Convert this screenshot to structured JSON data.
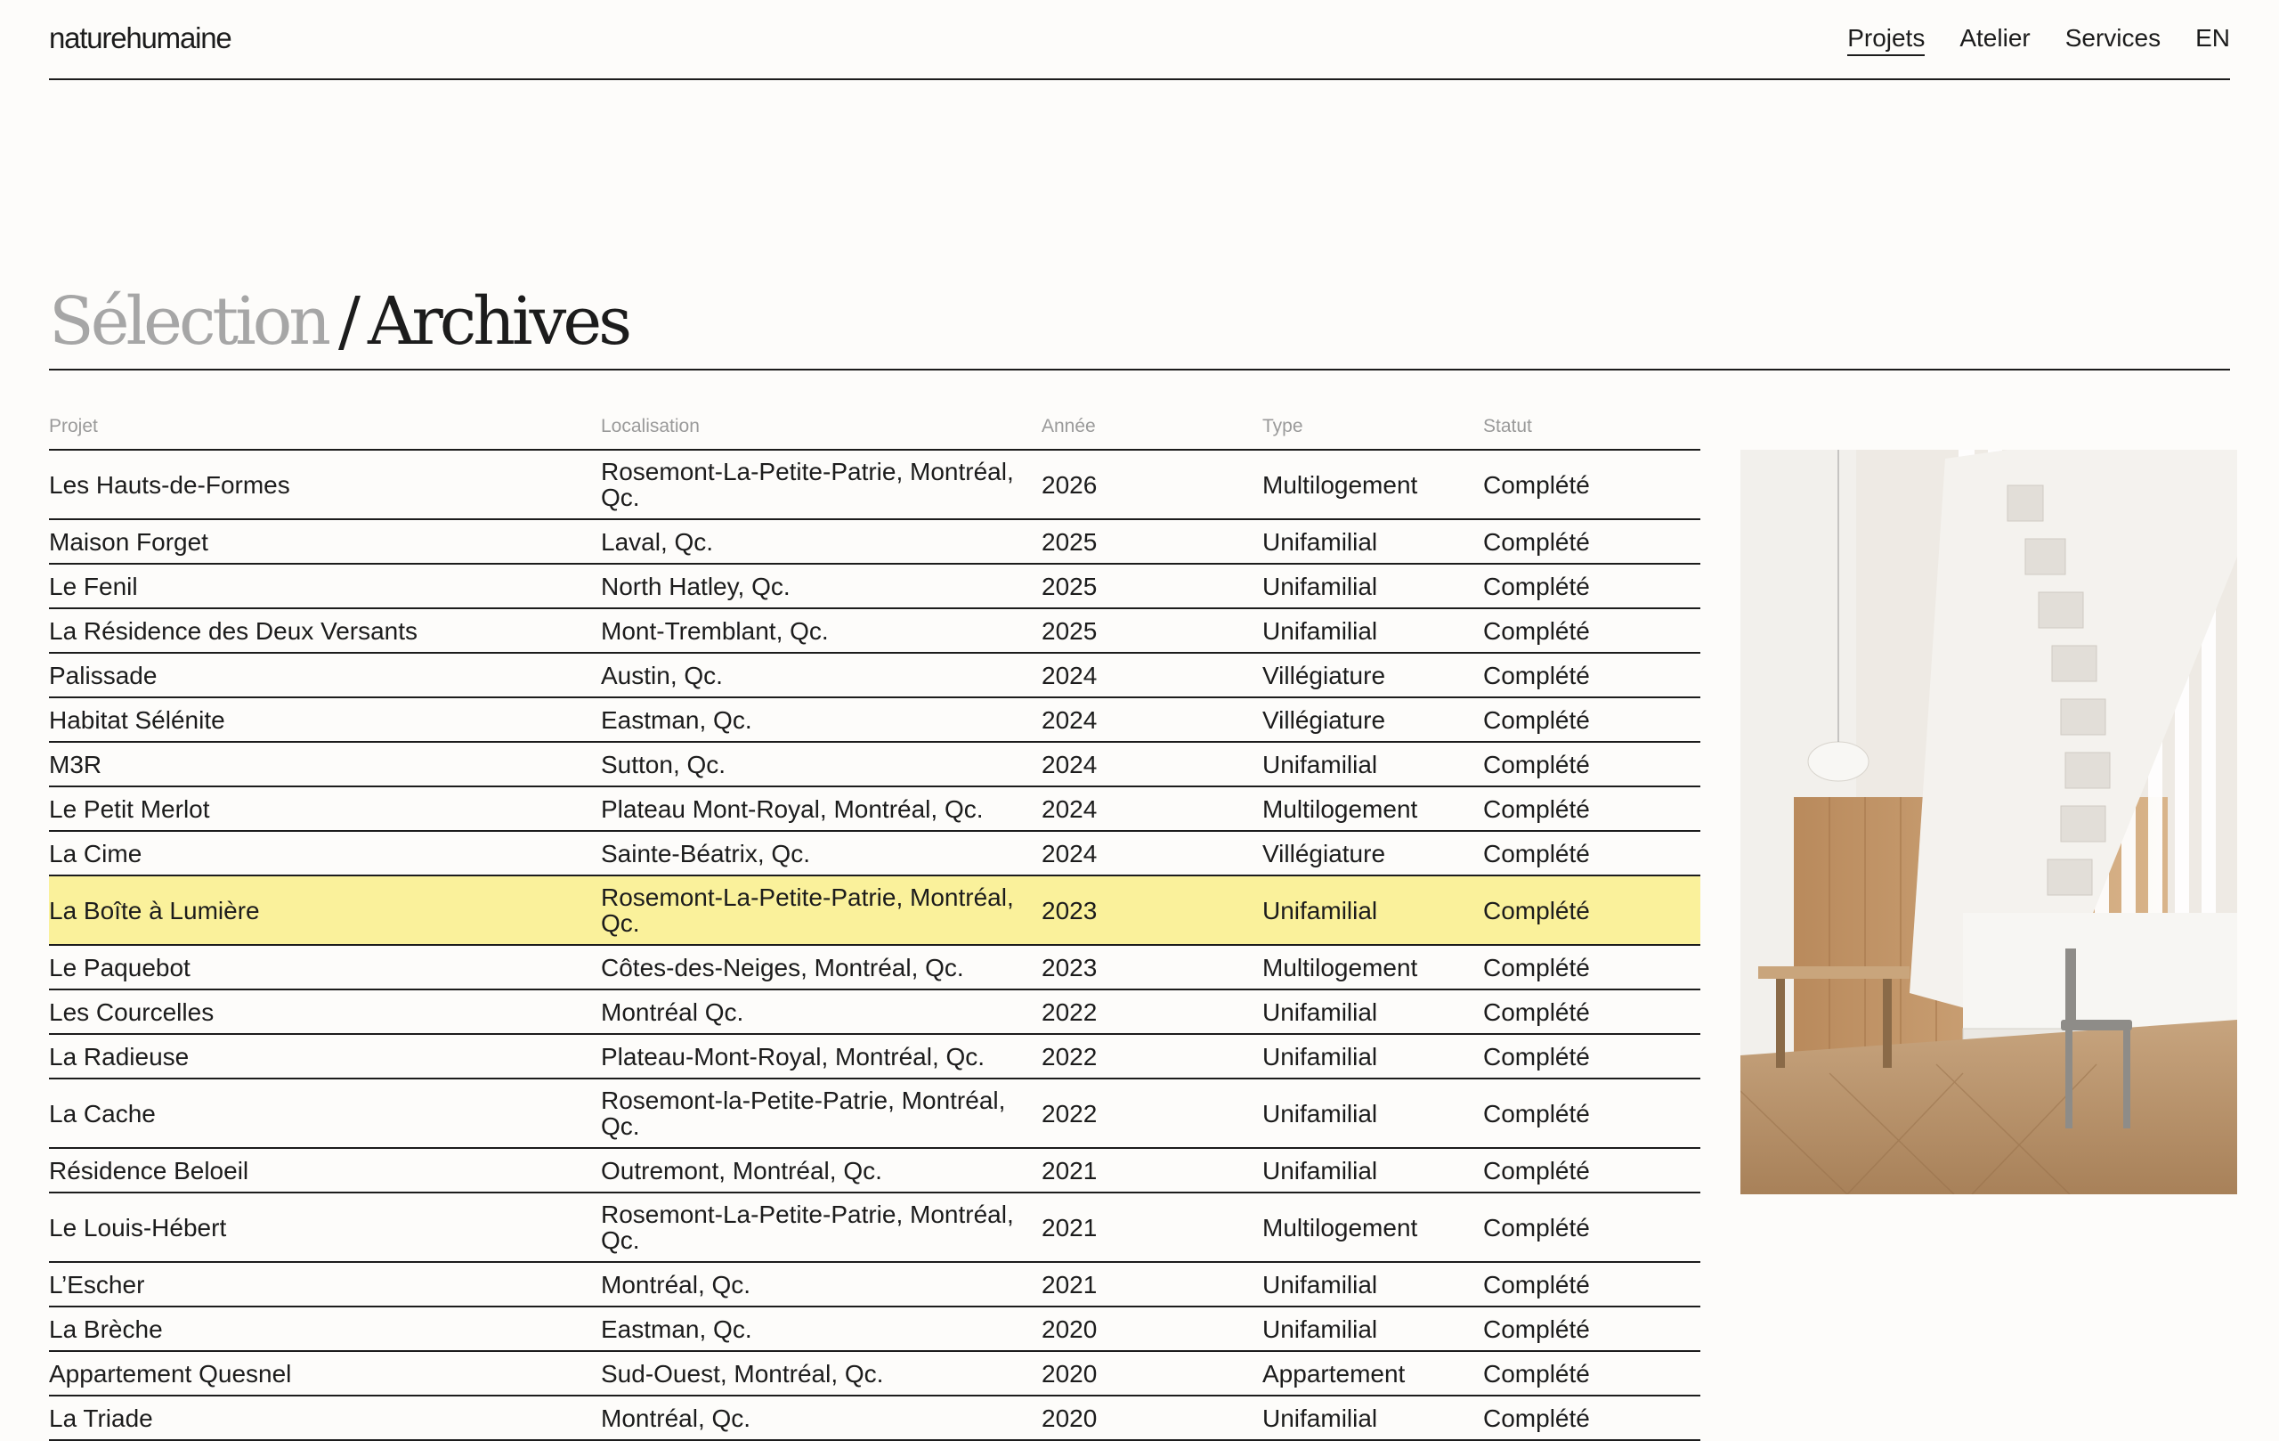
{
  "header": {
    "logo": "naturehumaine",
    "nav": [
      {
        "label": "Projets",
        "active": true
      },
      {
        "label": "Atelier",
        "active": false
      },
      {
        "label": "Services",
        "active": false
      },
      {
        "label": "EN",
        "active": false
      }
    ]
  },
  "title": {
    "selection": "Sélection",
    "separator": "/",
    "archives": "Archives"
  },
  "table": {
    "columns": [
      "Projet",
      "Localisation",
      "Année",
      "Type",
      "Statut"
    ],
    "rows": [
      {
        "name": "Les Hauts-de-Formes",
        "location": "Rosemont-La-Petite-Patrie, Montréal, Qc.",
        "year": "2026",
        "type": "Multilogement",
        "status": "Complété"
      },
      {
        "name": "Maison Forget",
        "location": "Laval, Qc.",
        "year": "2025",
        "type": "Unifamilial",
        "status": "Complété"
      },
      {
        "name": "Le Fenil",
        "location": "North Hatley, Qc.",
        "year": "2025",
        "type": "Unifamilial",
        "status": "Complété"
      },
      {
        "name": "La Résidence des Deux Versants",
        "location": "Mont-Tremblant, Qc.",
        "year": "2025",
        "type": "Unifamilial",
        "status": "Complété"
      },
      {
        "name": "Palissade",
        "location": "Austin, Qc.",
        "year": "2024",
        "type": "Villégiature",
        "status": "Complété"
      },
      {
        "name": "Habitat Sélénite",
        "location": "Eastman, Qc.",
        "year": "2024",
        "type": "Villégiature",
        "status": "Complété"
      },
      {
        "name": "M3R",
        "location": "Sutton, Qc.",
        "year": "2024",
        "type": "Unifamilial",
        "status": "Complété"
      },
      {
        "name": "Le Petit Merlot",
        "location": "Plateau Mont-Royal, Montréal, Qc.",
        "year": "2024",
        "type": "Multilogement",
        "status": "Complété"
      },
      {
        "name": "La Cime",
        "location": "Sainte-Béatrix, Qc.",
        "year": "2024",
        "type": "Villégiature",
        "status": "Complété"
      },
      {
        "name": "La Boîte à Lumière",
        "location": "Rosemont-La-Petite-Patrie, Montréal, Qc.",
        "year": "2023",
        "type": "Unifamilial",
        "status": "Complété"
      },
      {
        "name": "Le Paquebot",
        "location": "Côtes-des-Neiges, Montréal, Qc.",
        "year": "2023",
        "type": "Multilogement",
        "status": "Complété"
      },
      {
        "name": "Les Courcelles",
        "location": "Montréal Qc.",
        "year": "2022",
        "type": "Unifamilial",
        "status": "Complété"
      },
      {
        "name": "La Radieuse",
        "location": "Plateau-Mont-Royal, Montréal, Qc.",
        "year": "2022",
        "type": "Unifamilial",
        "status": "Complété"
      },
      {
        "name": "La Cache",
        "location": "Rosemont-la-Petite-Patrie, Montréal, Qc.",
        "year": "2022",
        "type": "Unifamilial",
        "status": "Complété"
      },
      {
        "name": "Résidence Beloeil",
        "location": "Outremont, Montréal, Qc.",
        "year": "2021",
        "type": "Unifamilial",
        "status": "Complété"
      },
      {
        "name": "Le Louis-Hébert",
        "location": "Rosemont-La-Petite-Patrie, Montréal, Qc.",
        "year": "2021",
        "type": "Multilogement",
        "status": "Complété"
      },
      {
        "name": "L’Escher",
        "location": "Montréal, Qc.",
        "year": "2021",
        "type": "Unifamilial",
        "status": "Complété"
      },
      {
        "name": "La Brèche",
        "location": "Eastman, Qc.",
        "year": "2020",
        "type": "Unifamilial",
        "status": "Complété"
      },
      {
        "name": "Appartement Quesnel",
        "location": "Sud-Ouest, Montréal, Qc.",
        "year": "2020",
        "type": "Appartement",
        "status": "Complété"
      },
      {
        "name": "La Triade",
        "location": "Montréal, Qc.",
        "year": "2020",
        "type": "Unifamilial",
        "status": "Complété"
      }
    ]
  },
  "colors": {
    "background": "#fdfcfa",
    "text": "#1c1c1c",
    "muted": "#a6a6a6",
    "highlight": "#faf19b"
  }
}
